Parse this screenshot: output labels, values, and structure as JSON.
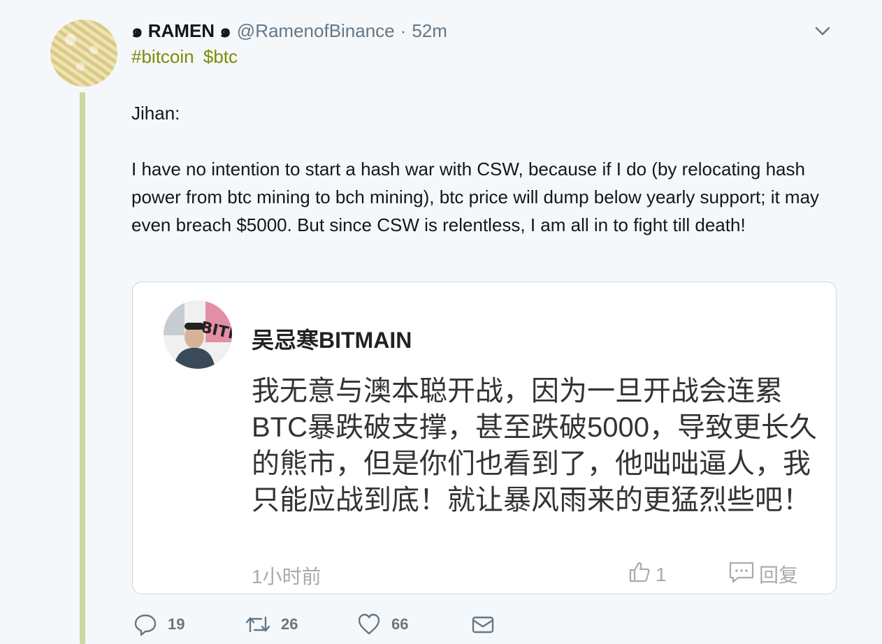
{
  "tweet": {
    "display_name": "๑ RAMEN ๑",
    "handle": "@RamenofBinance",
    "separator": "·",
    "time": "52m",
    "hashtags": [
      "#bitcoin",
      "$btc"
    ],
    "body_lines": [
      "Jihan:",
      "I have no intention to start a hash war with CSW, because if I do (by relocating hash power from btc mining to bch mining), btc price will dump below yearly support; it may even breach $5000. But since CSW is relentless, I am all in to fight till death!"
    ]
  },
  "embedded": {
    "name": "吴忌寒BITMAIN",
    "avatar_logo": "BITMAIN",
    "text": "我无意与澳本聪开战，因为一旦开战会连累BTC暴跌破支撑，甚至跌破5000，导致更长久的熊市，但是你们也看到了，他咄咄逼人，我只能应战到底！就让暴风雨来的更猛烈些吧！",
    "time": "1小时前",
    "like_count": "1",
    "reply_label": "回复"
  },
  "actions": {
    "reply_count": "19",
    "retweet_count": "26",
    "like_count": "66"
  },
  "colors": {
    "accent_hashtag": "#7c8a07",
    "thread_line": "#ccd6a0",
    "muted": "#657786"
  },
  "icons": [
    "chevron-down-icon",
    "reply-icon",
    "retweet-icon",
    "heart-icon",
    "dm-icon",
    "thumb-up-icon",
    "comment-icon"
  ]
}
